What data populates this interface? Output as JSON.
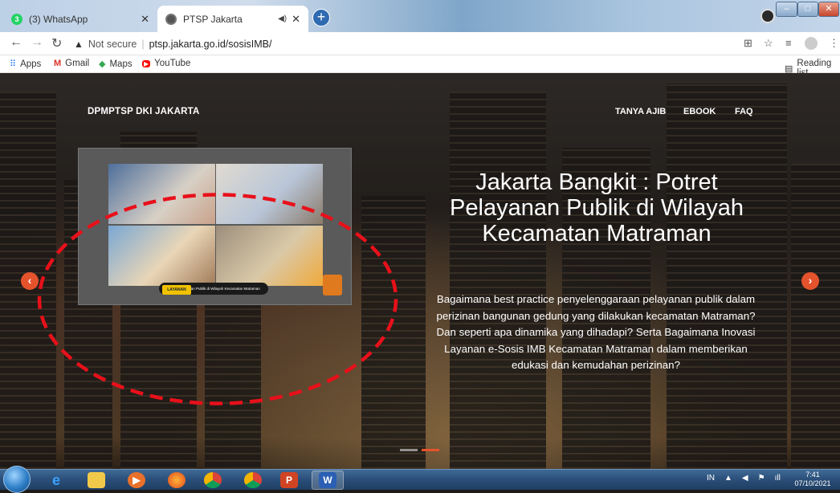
{
  "tabs": [
    {
      "title": "(3) WhatsApp",
      "favicon_color": "#25D366",
      "favicon_text": "3"
    },
    {
      "title": "PTSP Jakarta",
      "favicon_color": "#555555",
      "favicon_text": ""
    }
  ],
  "addressbar": {
    "security_label": "Not secure",
    "url": "ptsp.jakarta.go.id/sosisIMB/"
  },
  "bookmarks": [
    {
      "label": "Apps",
      "icon": "apps-grid-icon"
    },
    {
      "label": "Gmail",
      "icon": "gmail-icon"
    },
    {
      "label": "Maps",
      "icon": "maps-icon"
    },
    {
      "label": "YouTube",
      "icon": "youtube-icon"
    }
  ],
  "reading_list": "Reading list",
  "site": {
    "brand": "DPMPTSP DKI JAKARTA",
    "nav": [
      "TANYA AJIB",
      "EBOOK",
      "FAQ"
    ],
    "accent": "#E5532D"
  },
  "hero": {
    "title": "Jakarta Bangkit : Potret Pelayanan Publik di Wilayah Kecamatan Matraman",
    "description": "Bagaimana best practice penyelenggaraan pelayanan publik dalam perizinan bangunan gedung yang dilakukan kecamatan Matraman? Dan seperti apa dinamika yang dihadapi? Serta Bagaimana Inovasi Layanan e-Sosis IMB Kecamatan Matraman dalam memberikan edukasi dan kemudahan perizinan?"
  },
  "video": {
    "tag": "LAYANAN",
    "caption": "Potret Pelayanan Publik di Wilayah Kecamatan Matraman"
  },
  "taskbar": {
    "language": "IN",
    "time": "7:41",
    "date": "07/10/2021"
  }
}
